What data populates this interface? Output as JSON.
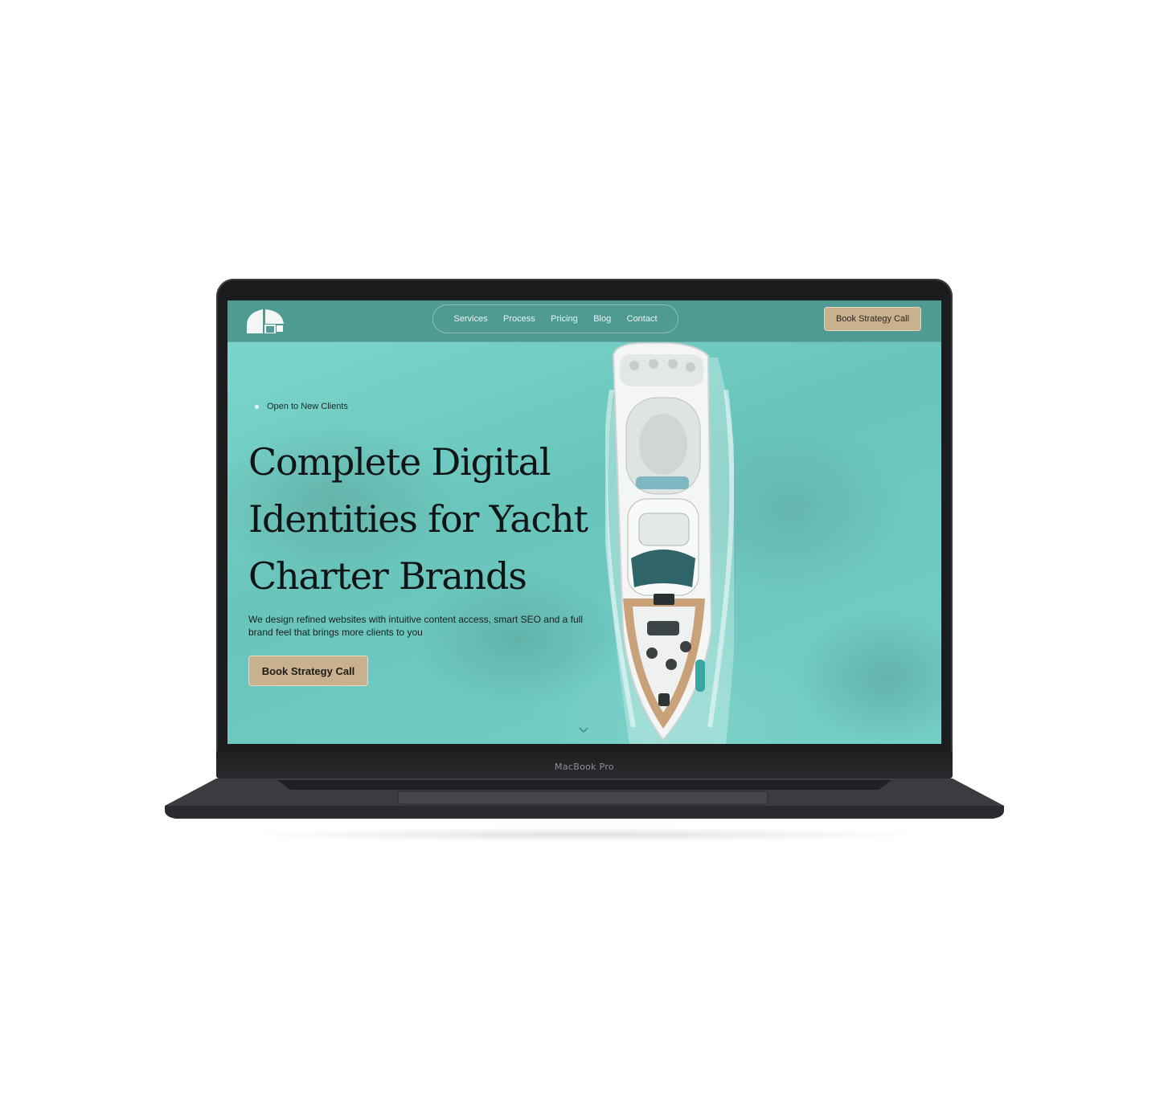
{
  "device": {
    "label": "MacBook Pro"
  },
  "nav": {
    "links": [
      "Services",
      "Process",
      "Pricing",
      "Blog",
      "Contact"
    ],
    "cta_label": "Book Strategy Call"
  },
  "hero": {
    "status": "Open to New Clients",
    "headline": "Complete Digital Identities for Yacht Charter Brands",
    "subtext": "We design refined websites with intuitive content access, smart SEO and a full brand feel that brings more clients to you",
    "cta_label": "Book Strategy Call"
  },
  "colors": {
    "accent": "#c9b08e",
    "nav_background": "#4f9a93",
    "water": "#5fc7bf",
    "text_dark": "#0f1515"
  },
  "icons": {
    "logo": "logo-icon",
    "scroll": "chevron-down-icon"
  }
}
